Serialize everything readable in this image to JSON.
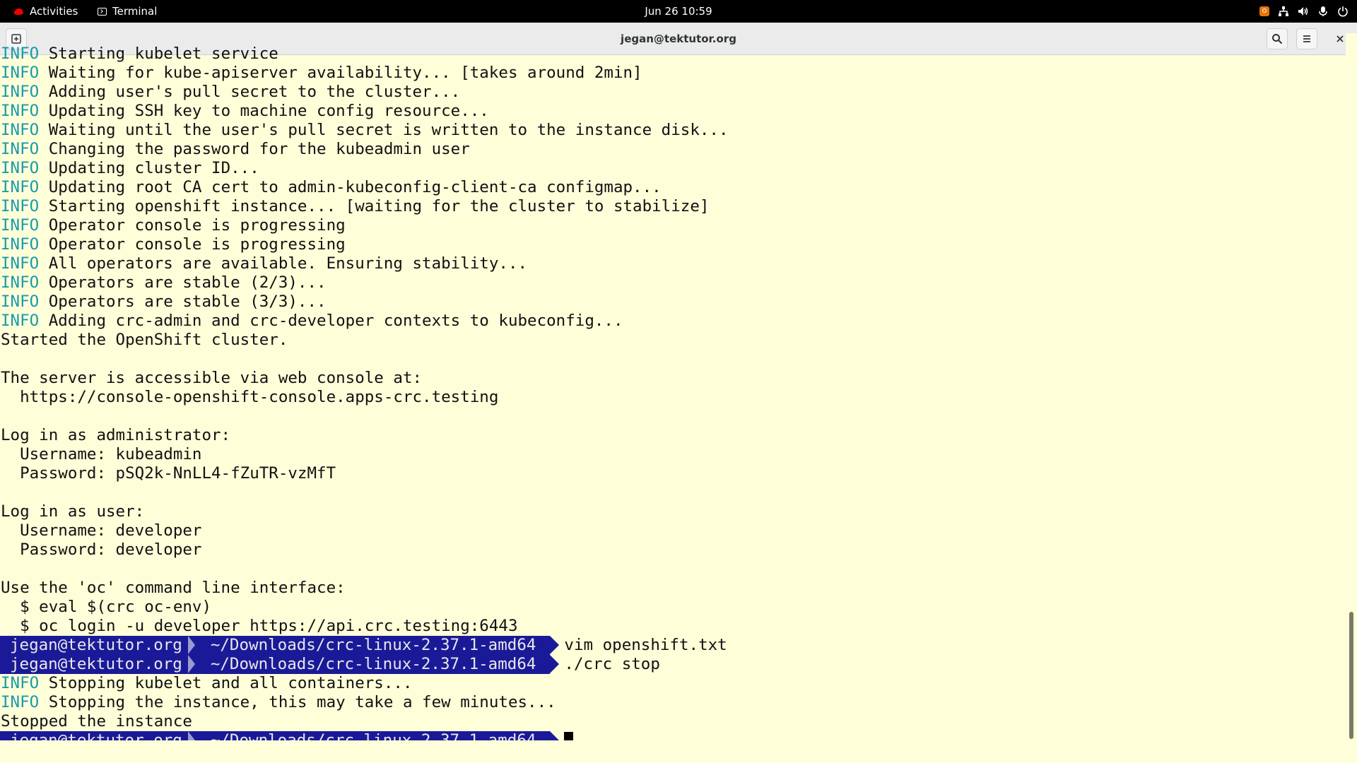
{
  "topbar": {
    "activities_label": "Activities",
    "app_label": "Terminal",
    "clock": "Jun 26  10:59",
    "tray_icons": [
      "orange-badge-icon",
      "network-icon",
      "volume-icon",
      "microphone-icon",
      "power-icon"
    ]
  },
  "window": {
    "title": "jegan@tektutor.org"
  },
  "prompt": {
    "user": "jegan@tektutor.org",
    "path": "~/Downloads/crc-linux-2.37.1-amd64"
  },
  "terminal": {
    "lines": [
      {
        "kind": "info",
        "tag": "INFO",
        "text": " Starting kubelet service"
      },
      {
        "kind": "info",
        "tag": "INFO",
        "text": " Waiting for kube-apiserver availability... [takes around 2min]"
      },
      {
        "kind": "info",
        "tag": "INFO",
        "text": " Adding user's pull secret to the cluster..."
      },
      {
        "kind": "info",
        "tag": "INFO",
        "text": " Updating SSH key to machine config resource..."
      },
      {
        "kind": "info",
        "tag": "INFO",
        "text": " Waiting until the user's pull secret is written to the instance disk..."
      },
      {
        "kind": "info",
        "tag": "INFO",
        "text": " Changing the password for the kubeadmin user"
      },
      {
        "kind": "info",
        "tag": "INFO",
        "text": " Updating cluster ID..."
      },
      {
        "kind": "info",
        "tag": "INFO",
        "text": " Updating root CA cert to admin-kubeconfig-client-ca configmap..."
      },
      {
        "kind": "info",
        "tag": "INFO",
        "text": " Starting openshift instance... [waiting for the cluster to stabilize]"
      },
      {
        "kind": "info",
        "tag": "INFO",
        "text": " Operator console is progressing"
      },
      {
        "kind": "info",
        "tag": "INFO",
        "text": " Operator console is progressing"
      },
      {
        "kind": "info",
        "tag": "INFO",
        "text": " All operators are available. Ensuring stability..."
      },
      {
        "kind": "info",
        "tag": "INFO",
        "text": " Operators are stable (2/3)..."
      },
      {
        "kind": "info",
        "tag": "INFO",
        "text": " Operators are stable (3/3)..."
      },
      {
        "kind": "info",
        "tag": "INFO",
        "text": " Adding crc-admin and crc-developer contexts to kubeconfig..."
      },
      {
        "kind": "plain",
        "text": "Started the OpenShift cluster."
      },
      {
        "kind": "plain",
        "text": ""
      },
      {
        "kind": "plain",
        "text": "The server is accessible via web console at:"
      },
      {
        "kind": "plain",
        "text": "  https://console-openshift-console.apps-crc.testing"
      },
      {
        "kind": "plain",
        "text": ""
      },
      {
        "kind": "plain",
        "text": "Log in as administrator:"
      },
      {
        "kind": "plain",
        "text": "  Username: kubeadmin"
      },
      {
        "kind": "plain",
        "text": "  Password: pSQ2k-NnLL4-fZuTR-vzMfT"
      },
      {
        "kind": "plain",
        "text": ""
      },
      {
        "kind": "plain",
        "text": "Log in as user:"
      },
      {
        "kind": "plain",
        "text": "  Username: developer"
      },
      {
        "kind": "plain",
        "text": "  Password: developer"
      },
      {
        "kind": "plain",
        "text": ""
      },
      {
        "kind": "plain",
        "text": "Use the 'oc' command line interface:"
      },
      {
        "kind": "plain",
        "text": "  $ eval $(crc oc-env)"
      },
      {
        "kind": "plain",
        "text": "  $ oc login -u developer https://api.crc.testing:6443"
      },
      {
        "kind": "prompt",
        "command": "vim openshift.txt"
      },
      {
        "kind": "prompt",
        "command": "./crc stop"
      },
      {
        "kind": "info",
        "tag": "INFO",
        "text": " Stopping kubelet and all containers..."
      },
      {
        "kind": "info",
        "tag": "INFO",
        "text": " Stopping the instance, this may take a few minutes..."
      },
      {
        "kind": "plain",
        "text": "Stopped the instance"
      },
      {
        "kind": "prompt",
        "command": "",
        "cursor": true
      }
    ]
  },
  "scrollbar": {
    "position_fraction": 0.82,
    "visible_fraction": 0.18
  }
}
